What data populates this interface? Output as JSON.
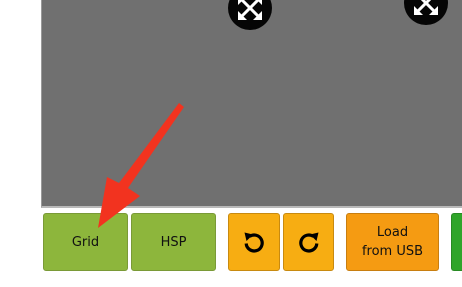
{
  "toolbar": {
    "grid_label": "Grid",
    "hsp_label": "HSP",
    "load_line1": "Load",
    "load_line2": "from USB"
  },
  "icons": {
    "resize_handle": "expand-arrows-icon",
    "rotate_left": "rotate-left-icon",
    "rotate_right": "rotate-right-icon",
    "annotation": "red-arrow-annotation"
  },
  "colors": {
    "preview_bg": "#707070",
    "green_button": "#8db63c",
    "orange_button": "#f7ad12",
    "load_button": "#f59b12",
    "annotation_arrow": "#f2331f"
  }
}
